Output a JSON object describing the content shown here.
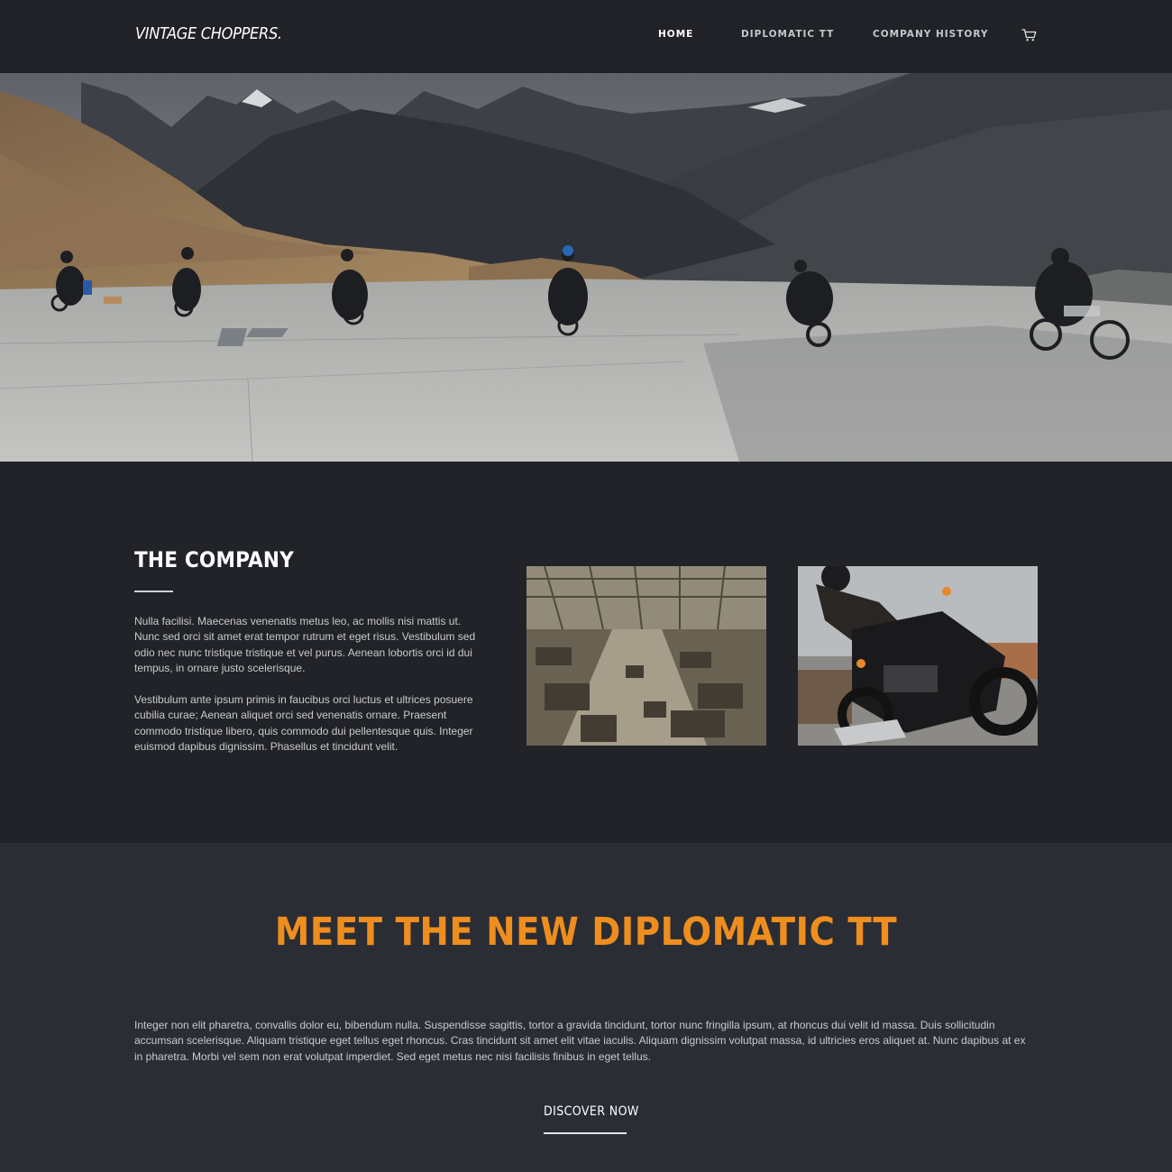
{
  "header": {
    "logo": "VINTAGE CHOPPERS.",
    "nav": [
      {
        "label": "HOME",
        "active": true
      },
      {
        "label": "DIPLOMATIC TT",
        "active": false
      },
      {
        "label": "COMPANY HISTORY",
        "active": false
      }
    ],
    "cart_icon": "shopping-cart-icon"
  },
  "hero": {
    "image": "riders-on-mountain-plateau-photo"
  },
  "company": {
    "title": "THE COMPANY",
    "paragraphs": [
      "Nulla facilisi. Maecenas venenatis metus leo, ac mollis nisi mattis ut. Nunc sed orci sit amet erat tempor rutrum et eget risus. Vestibulum sed odio nec nunc tristique tristique et vel purus. Aenean lobortis orci id dui tempus, in ornare justo scelerisque.",
      "Vestibulum ante ipsum primis in faucibus orci luctus et ultrices posuere cubilia curae; Aenean aliquet orci sed venenatis ornare. Praesent commodo tristique libero, quis commodo dui pellentesque quis. Integer euismod dapibus dignissim. Phasellus et tincidunt velit."
    ],
    "images": [
      "vintage-factory-photo",
      "rider-on-motorcycle-photo"
    ]
  },
  "diplomatic": {
    "heading": "MEET THE NEW DIPLOMATIC TT",
    "text": "Integer non elit pharetra, convallis dolor eu, bibendum nulla. Suspendisse sagittis, tortor a gravida tincidunt, tortor nunc fringilla ipsum, at rhoncus dui velit id massa. Duis sollicitudin accumsan scelerisque. Aliquam tristique eget tellus eget rhoncus. Cras tincidunt sit amet elit vitae iaculis. Aliquam dignissim volutpat massa, id ultricies eros aliquet at. Nunc dapibus at ex in pharetra. Morbi vel sem non erat volutpat imperdiet. Sed eget metus nec nisi facilisis finibus in eget tellus.",
    "cta": "DISCOVER NOW"
  },
  "colors": {
    "accent": "#ee8e1f",
    "header_bg": "#202228",
    "section_dark": "#212329",
    "section_mid": "#2b2d35"
  }
}
